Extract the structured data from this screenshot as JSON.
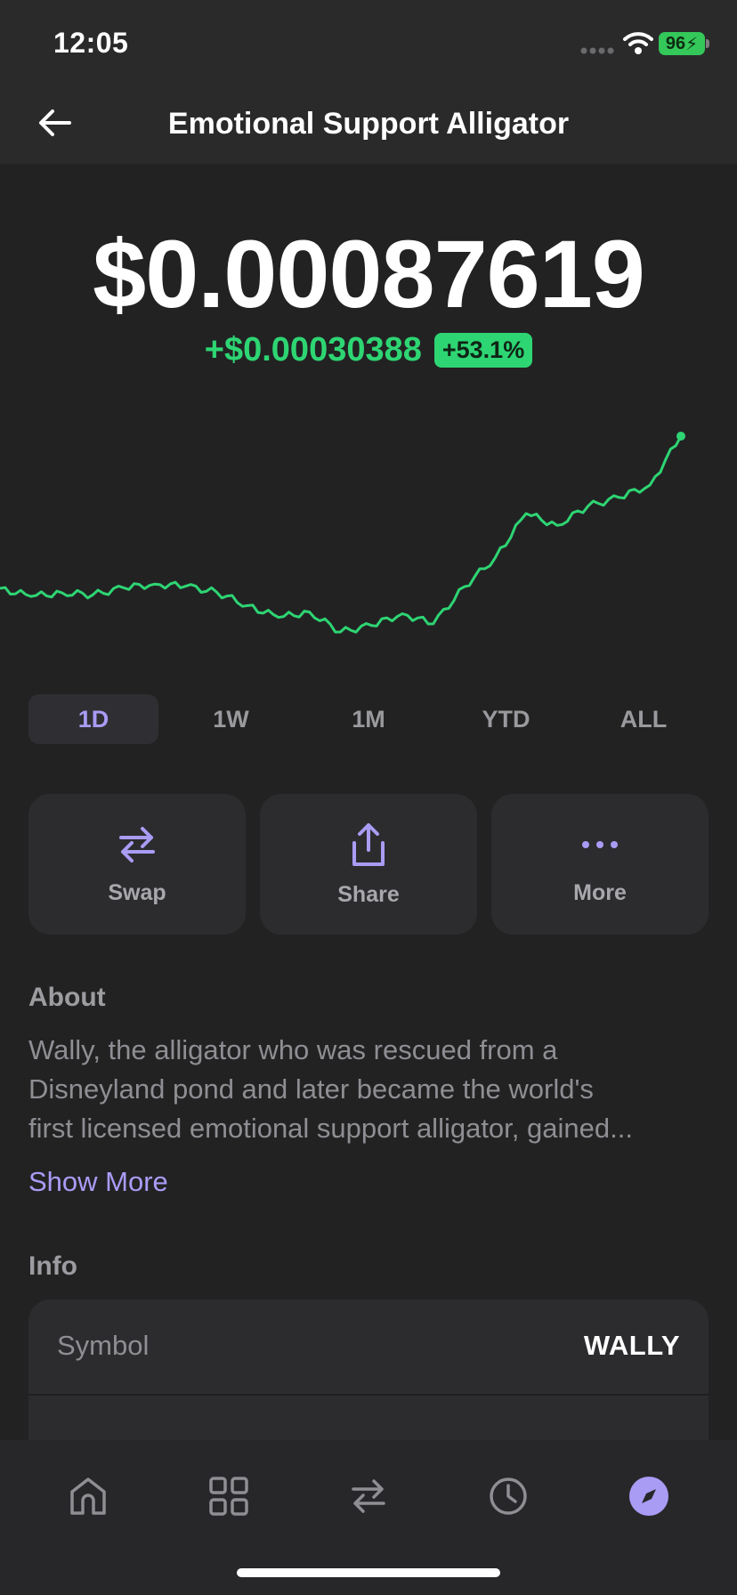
{
  "status_bar": {
    "time": "12:05",
    "battery": "96"
  },
  "header": {
    "title": "Emotional Support Alligator"
  },
  "price": {
    "current": "$0.00087619",
    "change_abs": "+$0.00030388",
    "change_pct": "+53.1%"
  },
  "chart_data": {
    "type": "line",
    "series": [
      {
        "values": [
          0.000593,
          0.000578,
          0.000585,
          0.000581,
          0.000594,
          0.000601,
          0.000597,
          0.000586,
          0.000561,
          0.000539,
          0.000549,
          0.000512,
          0.000524,
          0.000546,
          0.000527,
          0.000596,
          0.00065,
          0.000732,
          0.00071,
          0.000746,
          0.000762,
          0.000785,
          0.000876
        ]
      }
    ],
    "color": "#2ed573"
  },
  "ranges": [
    {
      "label": "1D",
      "active": true
    },
    {
      "label": "1W",
      "active": false
    },
    {
      "label": "1M",
      "active": false
    },
    {
      "label": "YTD",
      "active": false
    },
    {
      "label": "ALL",
      "active": false
    }
  ],
  "actions": [
    {
      "label": "Swap",
      "icon": "swap-icon"
    },
    {
      "label": "Share",
      "icon": "share-icon"
    },
    {
      "label": "More",
      "icon": "more-dots-icon"
    }
  ],
  "about": {
    "title": "About",
    "lines": [
      "Wally, the alligator who was rescued from a",
      "Disneyland pond and later became the world's",
      "first licensed emotional support alligator, gained..."
    ],
    "show_more": "Show More"
  },
  "info": {
    "title": "Info",
    "rows": [
      {
        "key": "Symbol",
        "value": "WALLY"
      }
    ]
  },
  "tab_bar": {
    "items": [
      {
        "icon": "home-icon",
        "active": false
      },
      {
        "icon": "grid-icon",
        "active": false
      },
      {
        "icon": "swap-icon",
        "active": false
      },
      {
        "icon": "clock-icon",
        "active": false
      },
      {
        "icon": "compass-icon",
        "active": true
      }
    ]
  },
  "colors": {
    "accent": "#a99cf5",
    "positive": "#2ed573",
    "background": "#222223"
  }
}
